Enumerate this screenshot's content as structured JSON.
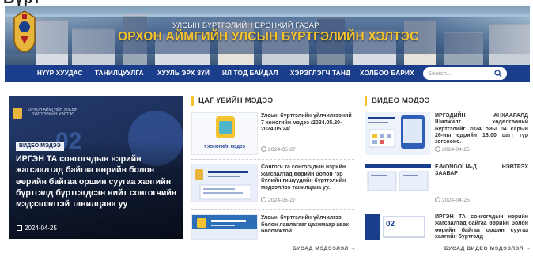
{
  "partial_heading": "Бүрт",
  "header": {
    "subtitle": "УЛСЫН БҮРТГЭЛИЙН ЕРӨНХИЙ ГАЗАР",
    "title": "ОРХОН АЙМГИЙН УЛСЫН БҮРТГЭЛИЙН ХЭЛТЭС"
  },
  "nav": {
    "items": [
      "НҮҮР ХУУДАС",
      "ТАНИЛЦУУЛГА",
      "ХУУЛЬ ЭРХ ЗҮЙ",
      "ИЛ ТОД БАЙДАЛ",
      "ХЭРЭГЛЭГЧ ТАНД",
      "ХОЛБОО БАРИХ"
    ],
    "search_placeholder": "Search..."
  },
  "featured": {
    "badge": "ВИДЕО МЭДЭЭ",
    "title": "ИРГЭН ТА сонгогчдын нэрийн жагсаалтад байгаа өөрийн болон өөрийн байгаа оршин суугаа хаягийн бүртгэлд бүртгэгдсэн нийт сонгогчийн мэдээлэлтэй танилцана уу",
    "date": "2024-04-25",
    "image_text": "ОРХОН АЙМГИЙН УЛСЫН БҮРТГЭЛИЙН ХЭЛТЭС",
    "image_number": "02"
  },
  "news_column": {
    "heading": "ЦАГ ҮЕИЙН МЭДЭЭ",
    "items": [
      {
        "title": "Улсын бүртгэлийн үйлчилгээний 7 хоногийн мэдээ /2024.05.20-2024.05.24/",
        "date": "2024-05-27",
        "thumb_text": "7 ХОНОГИЙН МЭДЭЭ"
      },
      {
        "title": "Сонгогч та сонгогчдын нэрийн жагсаалтад өөрийн болон гэр бүлийн гишүүдийн бүртгэлийн мэдээллээ танилцана уу.",
        "date": "2024-05-27"
      },
      {
        "title": "Улсын бүртгэлийн үйлчилгээ болон лавлагааг цахимаар авах боломжтой.",
        "date": ""
      }
    ],
    "more": "БУСАД МЭДЭЭЛЭЛ →"
  },
  "video_column": {
    "heading": "ВИДЕО МЭДЭЭ",
    "items": [
      {
        "title": "ИРГЭДИЙН АНХААРАЛД Шилжилт хөдөлгөөний бүртгэлийг 2024 оны 04 сарын 26-ны өдрийн 18:00 цагт түр зогсооно.",
        "date": "2024-04-25"
      },
      {
        "title": "E-MONGOLIA-Д НЭВТРЭХ ЗААВАР",
        "date": "2024-04-25"
      },
      {
        "title": "ИРГЭН ТА сонгогчдын нэрийн жагсаалтад байгаа өөрийн болон өөрийн байгаа оршин суугаа хаягийн бүртгэлд",
        "date": "",
        "thumb_number": "02"
      }
    ],
    "more": "БУСАД ВИДЕО МЭДЭЭЛЭЛ →"
  },
  "colors": {
    "nav_bg": "#1b3e8c",
    "accent_gold": "#f4c430",
    "title_gold": "#f4c430"
  }
}
